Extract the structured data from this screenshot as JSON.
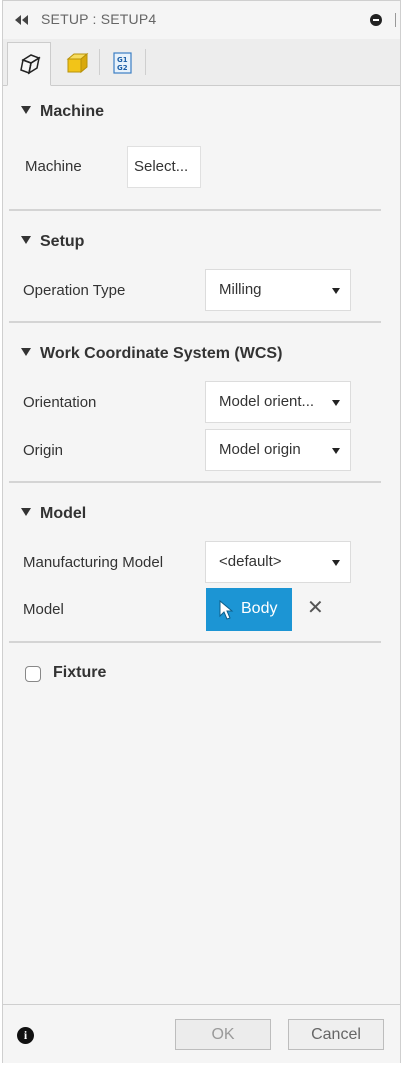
{
  "window": {
    "title": "SETUP : SETUP4",
    "collapse_icon": "double-left-chevron-icon",
    "minimize_icon": "minus-circle-icon"
  },
  "tabs": [
    {
      "name": "setup-tab",
      "icon": "setup-box-outline-icon",
      "active": true
    },
    {
      "name": "stock-tab",
      "icon": "stock-yellow-box-icon",
      "active": false
    },
    {
      "name": "post-process-tab",
      "icon": "g1-g2-icon",
      "active": false,
      "icon_text": [
        "G1",
        "G2"
      ]
    }
  ],
  "sections": {
    "machine": {
      "header": "Machine",
      "machine_label": "Machine",
      "machine_button": "Select..."
    },
    "setup": {
      "header": "Setup",
      "operation_type_label": "Operation Type",
      "operation_type_value": "Milling"
    },
    "wcs": {
      "header": "Work Coordinate System (WCS)",
      "orientation_label": "Orientation",
      "orientation_value": "Model orient...",
      "origin_label": "Origin",
      "origin_value": "Model origin"
    },
    "model": {
      "header": "Model",
      "manufacturing_model_label": "Manufacturing Model",
      "manufacturing_model_value": "<default>",
      "model_label": "Model",
      "model_button": "Body",
      "clear_symbol": "✕"
    },
    "fixture": {
      "label": "Fixture",
      "checked": false
    }
  },
  "footer": {
    "info_symbol": "i",
    "ok_label": "OK",
    "cancel_label": "Cancel"
  },
  "colors": {
    "accent": "#1c95d4",
    "panel_bg": "#f5f5f5",
    "stock_yellow": "#f2c418"
  }
}
